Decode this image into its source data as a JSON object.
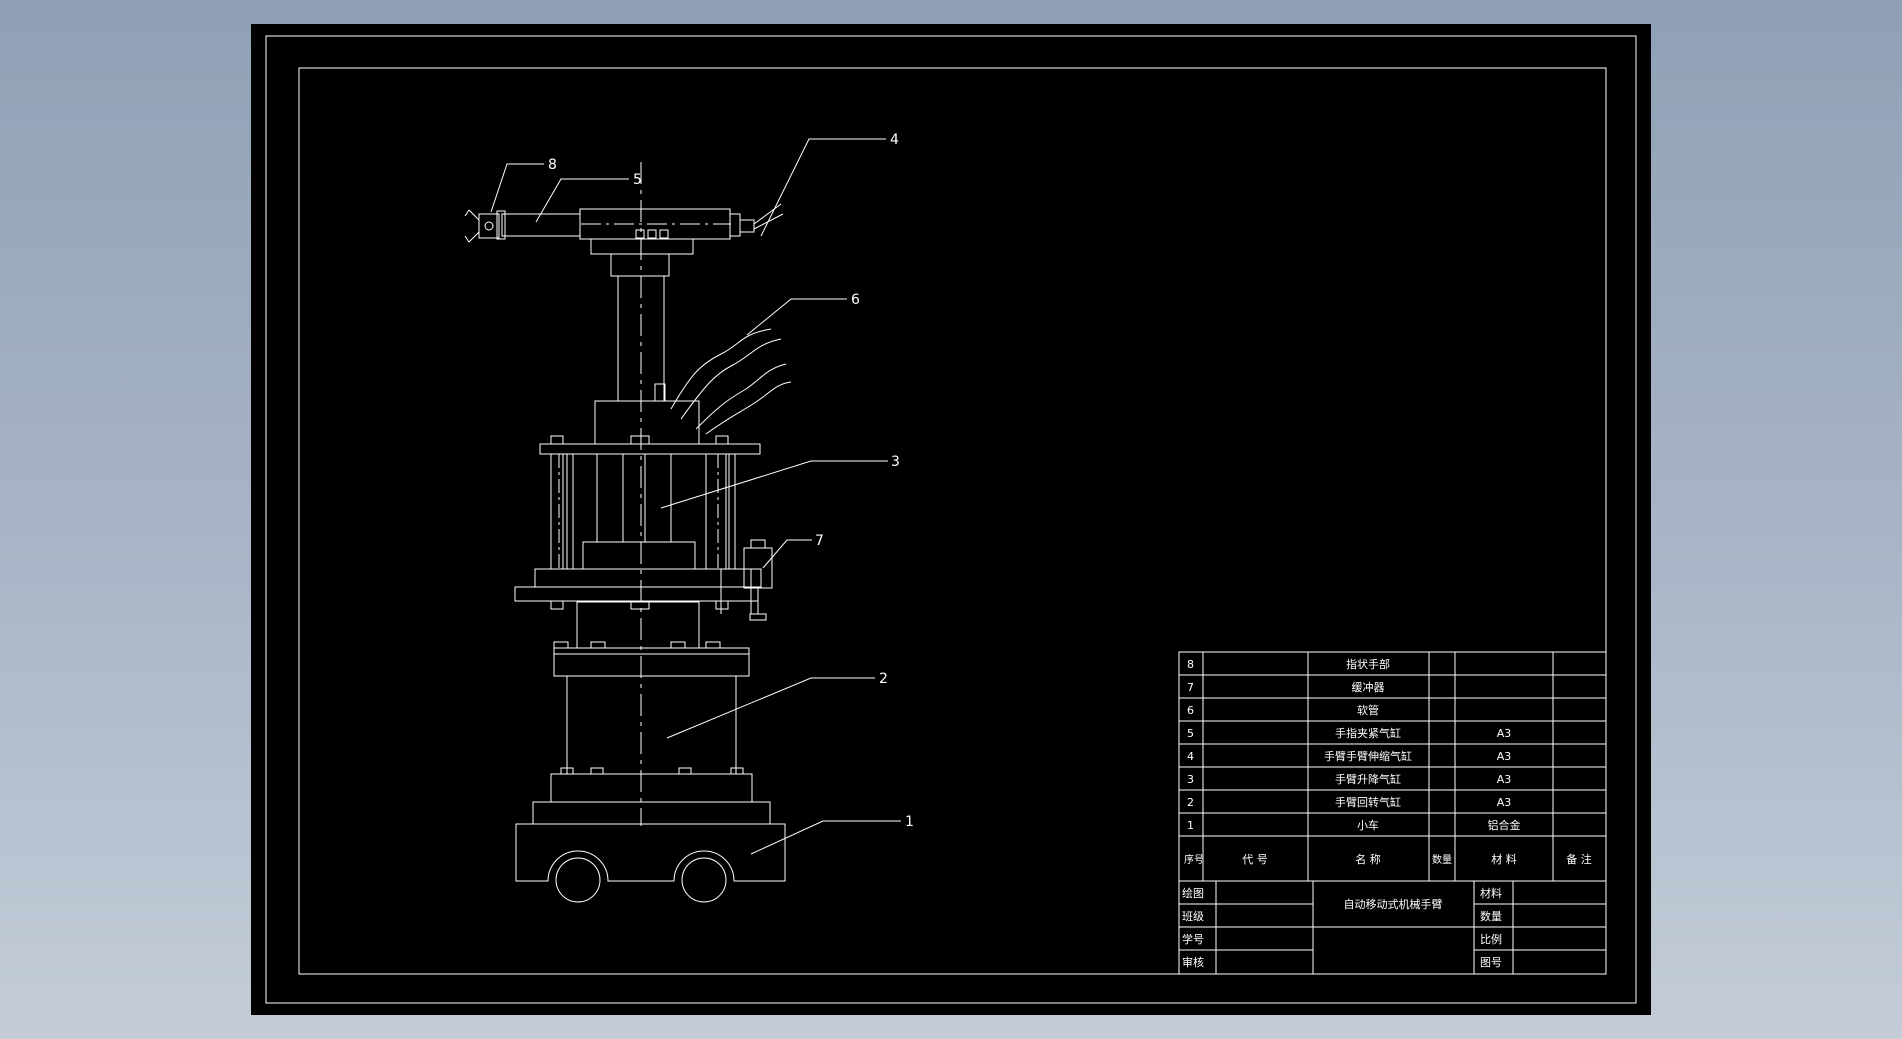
{
  "callouts": [
    "1",
    "2",
    "3",
    "4",
    "5",
    "6",
    "7",
    "8"
  ],
  "parts_list": [
    {
      "no": "8",
      "code": "",
      "name": "指状手部",
      "qty": "",
      "material": "",
      "remark": ""
    },
    {
      "no": "7",
      "code": "",
      "name": "缓冲器",
      "qty": "",
      "material": "",
      "remark": ""
    },
    {
      "no": "6",
      "code": "",
      "name": "软管",
      "qty": "",
      "material": "",
      "remark": ""
    },
    {
      "no": "5",
      "code": "",
      "name": "手指夹紧气缸",
      "qty": "",
      "material": "A3",
      "remark": ""
    },
    {
      "no": "4",
      "code": "",
      "name": "手臂手臂伸缩气缸",
      "qty": "",
      "material": "A3",
      "remark": ""
    },
    {
      "no": "3",
      "code": "",
      "name": "手臂升降气缸",
      "qty": "",
      "material": "A3",
      "remark": ""
    },
    {
      "no": "2",
      "code": "",
      "name": "手臂回转气缸",
      "qty": "",
      "material": "A3",
      "remark": ""
    },
    {
      "no": "1",
      "code": "",
      "name": "小车",
      "qty": "",
      "material": "铝合金",
      "remark": ""
    }
  ],
  "header": {
    "no": "序号",
    "code": "代  号",
    "name": "名  称",
    "qty": "数量",
    "material": "材 料",
    "remark": "备  注"
  },
  "title_block": {
    "drawn_label": "绘图",
    "class_label": "班级",
    "student_no_label": "学号",
    "review_label": "审核",
    "title": "自动移动式机械手臂",
    "material_label": "材料",
    "quantity_label": "数量",
    "scale_label": "比例",
    "drawing_no_label": "图号"
  }
}
